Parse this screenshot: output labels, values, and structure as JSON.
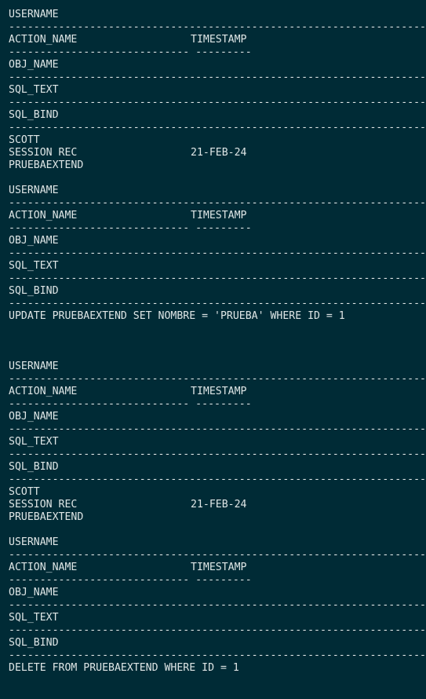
{
  "terminal": {
    "headers": {
      "username": "USERNAME",
      "action_name": "ACTION_NAME",
      "timestamp": "TIMESTAMP",
      "obj_name": "OBJ_NAME",
      "sql_text": "SQL_TEXT",
      "sql_bind": "SQL_BIND"
    },
    "rules": {
      "full": "------------------------------------------------------------------------------------------------------------------------",
      "action": "----------------------------- ---------"
    },
    "records": [
      {
        "username": "SCOTT",
        "action_name": "SESSION REC",
        "timestamp": "21-FEB-24",
        "obj_name": "PRUEBAEXTEND",
        "sql_text": "UPDATE PRUEBAEXTEND SET NOMBRE = 'PRUEBA' WHERE ID = 1"
      },
      {
        "username": "SCOTT",
        "action_name": "SESSION REC",
        "timestamp": "21-FEB-24",
        "obj_name": "PRUEBAEXTEND",
        "sql_text": "DELETE FROM PRUEBAEXTEND WHERE ID = 1"
      }
    ]
  }
}
